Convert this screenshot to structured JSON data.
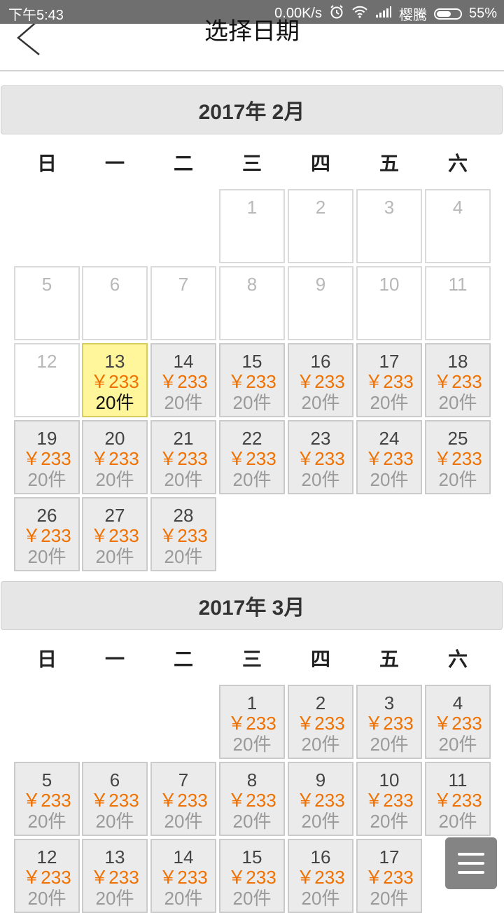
{
  "status_bar": {
    "time": "下午5:43",
    "speed": "0.00K/s",
    "carrier": "樱騰",
    "battery": "55%"
  },
  "header": {
    "title": "选择日期",
    "back_icon": "chevron-left-icon"
  },
  "weekdays": [
    "日",
    "一",
    "二",
    "三",
    "四",
    "五",
    "六"
  ],
  "months": [
    {
      "label": "2017年 2月",
      "first_weekday": 3,
      "days": 28,
      "available_from": 13,
      "selected_day": 13
    },
    {
      "label": "2017年 3月",
      "first_weekday": 3,
      "days": 17,
      "available_from": 1,
      "selected_day": null
    }
  ],
  "price_label": "￥233",
  "stock_label": "20件",
  "colors": {
    "price": "#f07000",
    "selected_bg": "#fff59a",
    "available_bg": "#ebebeb"
  },
  "float_menu_icon": "menu-icon"
}
